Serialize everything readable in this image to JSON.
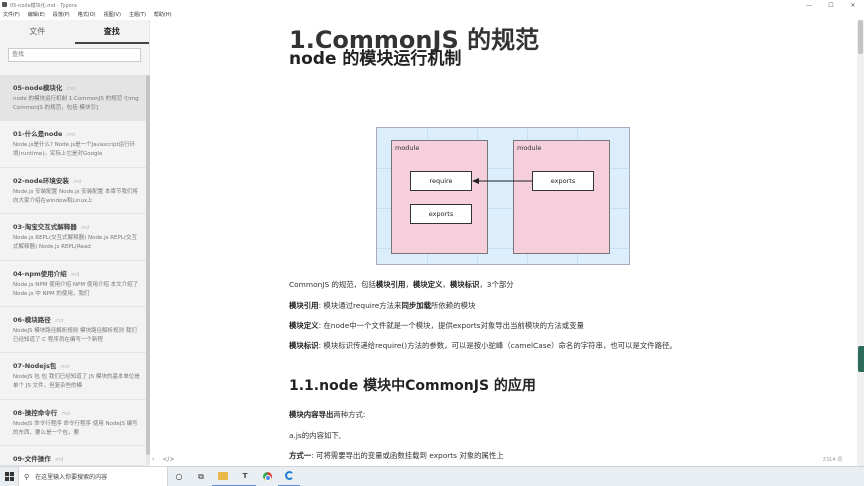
{
  "window": {
    "title": "05-node模块化.md - Typora",
    "controls": [
      "—",
      "☐",
      "✕"
    ]
  },
  "menu": [
    "文件(F)",
    "编辑(E)",
    "段落(P)",
    "格式(O)",
    "视图(V)",
    "主题(T)",
    "帮助(H)"
  ],
  "sidebar": {
    "tabs": [
      "文件",
      "查找"
    ],
    "active_tab": "查找",
    "search_placeholder": "查找",
    "files": [
      {
        "name": "05-node模块化",
        "ext": ".md",
        "preview": "node 的模块运行机制 1.CommonJS 的规范 ![img CommonJS 的规范，包括 模块引]"
      },
      {
        "name": "01-什么是node",
        "ext": ".md",
        "preview": "Node.js是什么? Node.js是一个Javascript运行环境(runtime)。实际上它是对Google"
      },
      {
        "name": "02-node环境安装",
        "ext": ".md",
        "preview": "Node.js 安装配置 Node.js 安装配置 本章节我们将向大家介绍在window和Linux上"
      },
      {
        "name": "03-淘宝交互式解释器",
        "ext": ".md",
        "preview": "Node.js REPL(交互式解释器) Node.js REPL(交互式解释器) Node.js REPL(Read"
      },
      {
        "name": "04-npm使用介绍",
        "ext": ".md",
        "preview": "Node.js NPM 使用介绍 NPM 使用介绍 本文介绍了 Node.js 中 NPM 的使用，我们"
      },
      {
        "name": "06-模块路径",
        "ext": ".md",
        "preview": "NodeJS 模块路径解析规则 模块路径解析规则 我们已经知道了 C 程序员在编写一个新程"
      },
      {
        "name": "07-Nodejs包",
        "ext": ".md",
        "preview": "NodeJS 包 包 我们已经知道了 JS 模块的基本单位是单个 JS 文件，但复杂些的模"
      },
      {
        "name": "08-操控命令行",
        "ext": ".md",
        "preview": "NodeJS 命令行程序 命令行程序 使用 NodeJS 编写的东西，要么是一个包，要"
      },
      {
        "name": "09-文件操作",
        "ext": ".md",
        "preview": ""
      }
    ]
  },
  "status": {
    "left_icons": [
      "‹",
      "</>"
    ],
    "word_count": "2314 词"
  },
  "doc": {
    "h1": "node 的模块运行机制",
    "h2_commonjs": "1.CommonJS 的规范",
    "diagram": {
      "left_module_label": "module",
      "right_module_label": "module",
      "require_label": "require",
      "left_exports_label": "exports",
      "right_exports_label": "exports"
    },
    "para1": {
      "pre": "CommonJS 的规范，包括",
      "b1": "模块引用",
      "sep1": "，",
      "b2": "模块定义",
      "sep2": "，",
      "b3": "模块标识",
      "post": "，3个部分"
    },
    "para2": {
      "label": "模块引用",
      "text1": ": 模块通过require方法来",
      "bold": "同步加载",
      "text2": "所依赖的模块"
    },
    "para3": {
      "label": "模块定义",
      "text": ": 在node中一个文件就是一个模块，提供exports对象导出当前模块的方法或变量"
    },
    "para4": {
      "label": "模块标识",
      "text": ": 模块标识传递给require()方法的参数，可以是按小驼峰（camelCase）命名的字符串，也可以是文件路径。"
    },
    "h2_app": "1.1.node 模块中CommonJS 的应用",
    "para5": {
      "bold": "模块内容导出",
      "text": "两种方式:"
    },
    "para6": "a.js的内容如下,",
    "para7": {
      "bold": "方式一",
      "text": ": 可将需要导出的变量或函数挂载到 exports 对象的属性上"
    }
  },
  "taskbar": {
    "search_placeholder": "在这里输入你要搜索的内容",
    "apps": [
      "task-view",
      "explorer",
      "typora",
      "chrome",
      "edge"
    ]
  }
}
